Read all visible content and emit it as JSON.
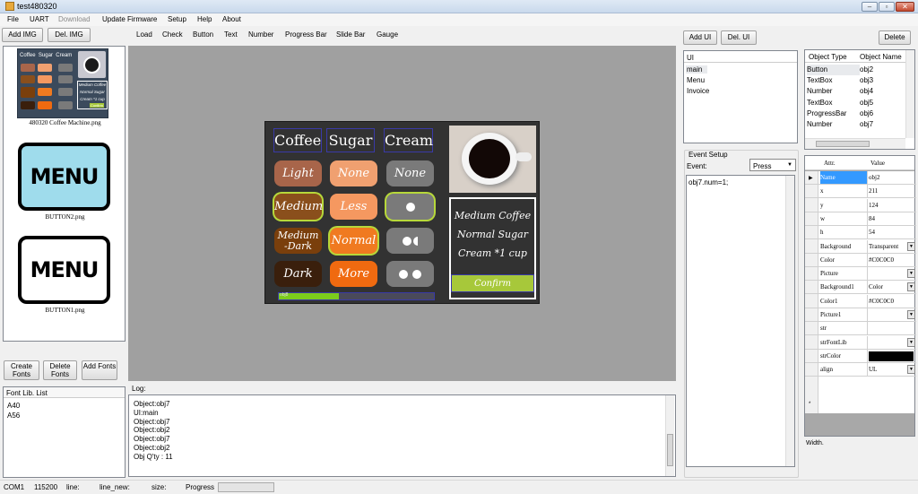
{
  "window": {
    "title": "test480320"
  },
  "menu": [
    "File",
    "UART",
    "Download",
    "Update Firmware",
    "Setup",
    "Help",
    "About"
  ],
  "toolbar": {
    "add_img": "Add IMG",
    "del_img": "Del. IMG",
    "tools": [
      "Load",
      "Check",
      "Button",
      "Text",
      "Number",
      "Progress Bar",
      "Slide Bar",
      "Gauge"
    ],
    "add_ui": "Add UI",
    "del_ui": "Del. UI",
    "delete": "Delete"
  },
  "images": [
    {
      "caption": "480320 Coffee Machine.png"
    },
    {
      "caption": "BUTTON2.png",
      "text": "MENU"
    },
    {
      "caption": "BUTTON1.png",
      "text": "MENU"
    }
  ],
  "thumb_mini": {
    "row1": [
      "Coffee",
      "Sugar",
      "Cream"
    ],
    "lines": [
      "Medium Coffee",
      "Normal Sugar",
      "Cream *1 cup"
    ],
    "confirm": "Confirm"
  },
  "fonts": {
    "create": "Create Fonts",
    "delete": "Delete Fonts",
    "add": "Add Fonts",
    "list_header": "Font Lib. List",
    "items": [
      "A40",
      "A56"
    ]
  },
  "device": {
    "headers": [
      "Coffee",
      "Sugar",
      "Cream"
    ],
    "col1": [
      "Light",
      "Medium",
      "Medium -Dark",
      "Dark"
    ],
    "col2": [
      "None",
      "Less",
      "Normal",
      "More"
    ],
    "col3_label": "None",
    "info": [
      "Medium Coffee",
      "Normal Sugar",
      "Cream *1 cup"
    ],
    "confirm": "Confirm",
    "progress": 0.39,
    "pbar_tag": "obj8",
    "colors": {
      "light": "#a8654a",
      "medium": "#8a4f1c",
      "mediumdark": "#7a3f0c",
      "dark": "#3a1f0c",
      "none": "#f0a070",
      "less": "#f59860",
      "normal": "#f07a20",
      "more": "#f06a10",
      "gray": "#7a7a7a",
      "confirm": "#a7c83a",
      "progress": "#7ccc1c"
    }
  },
  "log": {
    "label": "Log:",
    "lines": [
      "Object:obj7",
      "UI:main",
      "Object:obj7",
      "Object:obj2",
      "Object:obj7",
      "Object:obj2",
      "Obj Q'ty : 11"
    ]
  },
  "ui_list": {
    "header": "UI",
    "items": [
      "main",
      "Menu",
      "Invoice"
    ]
  },
  "event": {
    "group": "Event Setup",
    "label": "Event:",
    "value": "Press",
    "code": "obj7.num=1;"
  },
  "objects": {
    "headers": [
      "Object Type",
      "Object Name"
    ],
    "rows": [
      [
        "Button",
        "obj2"
      ],
      [
        "TextBox",
        "obj3"
      ],
      [
        "Number",
        "obj4"
      ],
      [
        "TextBox",
        "obj5"
      ],
      [
        "ProgressBar",
        "obj6"
      ],
      [
        "Number",
        "obj7"
      ]
    ]
  },
  "props": {
    "headers": [
      "Attr.",
      "Value"
    ],
    "rows": [
      [
        "Name",
        "obj2"
      ],
      [
        "x",
        "211"
      ],
      [
        "y",
        "124"
      ],
      [
        "w",
        "84"
      ],
      [
        "h",
        "54"
      ],
      [
        "Background",
        "Transparent"
      ],
      [
        "Color",
        "#C0C0C0"
      ],
      [
        "Picture",
        ""
      ],
      [
        "Background1",
        "Color"
      ],
      [
        "Color1",
        "#C0C0C0"
      ],
      [
        "Picture1",
        ""
      ],
      [
        "str",
        ""
      ],
      [
        "strFontLib",
        ""
      ],
      [
        "strColor",
        ""
      ],
      [
        "align",
        "UL"
      ]
    ],
    "width_label": "Width."
  },
  "status": {
    "com": "COM1",
    "baud": "115200",
    "line": "line:",
    "line_new": "line_new:",
    "size": "size:",
    "progress": "Progress"
  }
}
